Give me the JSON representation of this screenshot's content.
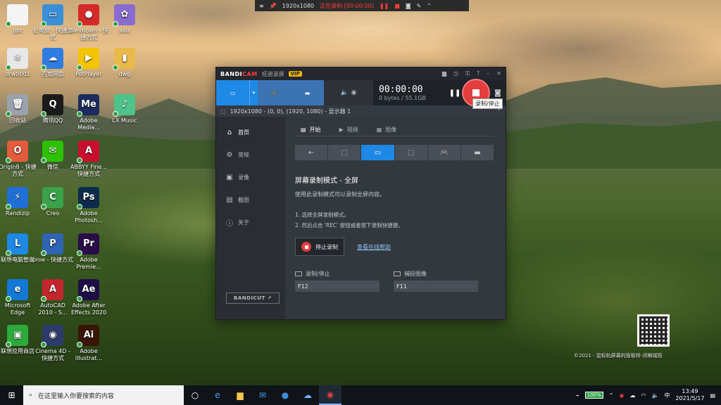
{
  "desktop": {
    "icons": [
      {
        "label": "ppt",
        "color": "#f4f4f4",
        "glyph": "",
        "x": 0
      },
      {
        "label": "此电脑 - 快捷方式",
        "color": "#3a8fd6",
        "glyph": "▭"
      },
      {
        "label": "Bandicam - 快捷方式",
        "color": "#d42a2a",
        "glyph": "●"
      },
      {
        "label": "saiz",
        "color": "#8a6bd0",
        "glyph": "✿"
      },
      {
        "label": "drw0001",
        "color": "#e8e8e8",
        "glyph": "❄"
      },
      {
        "label": "百度网盘",
        "color": "#2f7de1",
        "glyph": "☁"
      },
      {
        "label": "PotPlayer",
        "color": "#f4c400",
        "glyph": "▶"
      },
      {
        "label": "dwg",
        "color": "#e9b94a",
        "glyph": "▮"
      },
      {
        "label": "回收站",
        "color": "#9aa3ad",
        "glyph": "🗑"
      },
      {
        "label": "腾讯QQ",
        "color": "#1a1a1a",
        "glyph": "Q"
      },
      {
        "label": "Adobe Media...",
        "color": "#1d2b5e",
        "glyph": "Me"
      },
      {
        "label": "LX Music",
        "color": "#4fc48a",
        "glyph": "♪"
      },
      {
        "label": "Origin8 - 快捷方式",
        "color": "#e25b3a",
        "glyph": "O"
      },
      {
        "label": "微信",
        "color": "#2dc100",
        "glyph": "✉"
      },
      {
        "label": "ABBYY Fine... 快捷方式",
        "color": "#c8102e",
        "glyph": "A"
      },
      {
        "label": "Randizip",
        "color": "#1f6fd6",
        "glyph": "⚡"
      },
      {
        "label": "Creo",
        "color": "#3ca24a",
        "glyph": "C"
      },
      {
        "label": "Adobe Photosh...",
        "color": "#0c2a4a",
        "glyph": "Ps"
      },
      {
        "label": "联想电脑管家",
        "color": "#1e88e5",
        "glyph": "L"
      },
      {
        "label": "proe - 快捷方式",
        "color": "#2e64b3",
        "glyph": "P"
      },
      {
        "label": "Adobe Premie...",
        "color": "#2a0c4a",
        "glyph": "Pr"
      },
      {
        "label": "Microsoft Edge",
        "color": "#1479d6",
        "glyph": "e"
      },
      {
        "label": "AutoCAD 2010 - S...",
        "color": "#c2272d",
        "glyph": "A"
      },
      {
        "label": "Adobe After Effects 2020",
        "color": "#1e0e44",
        "glyph": "Ae"
      },
      {
        "label": "联想应用商店",
        "color": "#2dab3a",
        "glyph": "▣"
      },
      {
        "label": "Cinema 4D - 快捷方式",
        "color": "#2b3b6b",
        "glyph": "◉"
      },
      {
        "label": "Adobe Illustrat...",
        "color": "#3a1600",
        "glyph": "Ai"
      }
    ]
  },
  "rec_bar": {
    "resolution": "1920x1080",
    "status": "正在录制 [00:00:00]"
  },
  "bandicam": {
    "brand_a": "BANDI",
    "brand_b": "CAM",
    "brand_cn": "班迪录屏",
    "vip": "VIP",
    "timer": "00:00:00",
    "size": "0 bytes / 55.1GB",
    "tooltip": "录制/停止",
    "info_line": "1920x1080 - (0, 0), (1920, 1080) - 显示器 1",
    "sidebar": [
      {
        "label": "首页",
        "icon": "⌂"
      },
      {
        "label": "常规",
        "icon": "⚙"
      },
      {
        "label": "录像",
        "icon": "▣"
      },
      {
        "label": "截图",
        "icon": "▤"
      },
      {
        "label": "关于",
        "icon": "ⓘ"
      }
    ],
    "bandicut": "BANDICUT ↗",
    "subtabs": [
      {
        "label": "开始",
        "icon": "▤"
      },
      {
        "label": "视频",
        "icon": "▶"
      },
      {
        "label": "图像",
        "icon": "▦"
      }
    ],
    "mode_title": "屏幕录制模式 - 全屏",
    "mode_desc": "使用此录制模式可以录制全屏内容。",
    "step1": "1. 选择全屏录制模式。",
    "step2": "2. 然后点击 'REC' 按钮或者按下录制快捷键。",
    "stop_button": "停止录制",
    "help_link": "查看在线帮助",
    "hotkey_rec_label": "录制/停止",
    "hotkey_rec_value": "F12",
    "hotkey_img_label": "捕捉图像",
    "hotkey_img_value": "F11"
  },
  "watermark": "©2021 - 鼠标轨屏幕的面板师-闭稿城观",
  "taskbar": {
    "search_placeholder": "在这里输入你要搜索的内容",
    "battery": "100%",
    "ime": "中",
    "time": "13:49",
    "date": "2021/5/17"
  }
}
